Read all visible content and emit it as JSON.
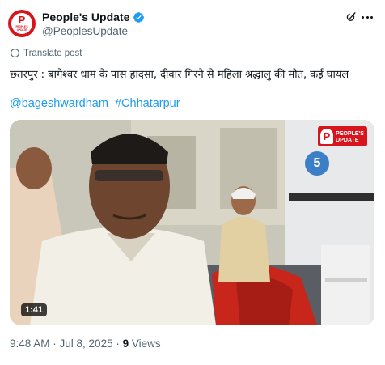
{
  "author": {
    "display_name": "People's Update",
    "handle": "@PeoplesUpdate",
    "avatar_line1": "PEOPLE'S",
    "avatar_line2": "UPDATE",
    "verified_color": "#1d9bf0"
  },
  "translate": {
    "label": "Translate post"
  },
  "tweet": {
    "text": "छतरपुर : बागेश्वर धाम के पास हादसा, दीवार गिरने से महिला श्रद्धालु की मौत, कई घायल",
    "hashtags": [
      "@bageshwardham",
      "#Chhatarpur"
    ]
  },
  "media": {
    "duration": "1:41",
    "logo_line1": "PEOPLE'S",
    "logo_line2": "UPDATE",
    "logo_letter": "P",
    "room_number": "5"
  },
  "meta": {
    "time": "9:48 AM",
    "separator": " · ",
    "date": "Jul 8, 2025",
    "views_count": "9",
    "views_label": " Views"
  },
  "colors": {
    "link": "#1d9bf0",
    "brand": "#d8141c",
    "muted": "#536471"
  },
  "icons": [
    "verified-badge-icon",
    "grok-icon",
    "more-icon",
    "translate-icon"
  ]
}
